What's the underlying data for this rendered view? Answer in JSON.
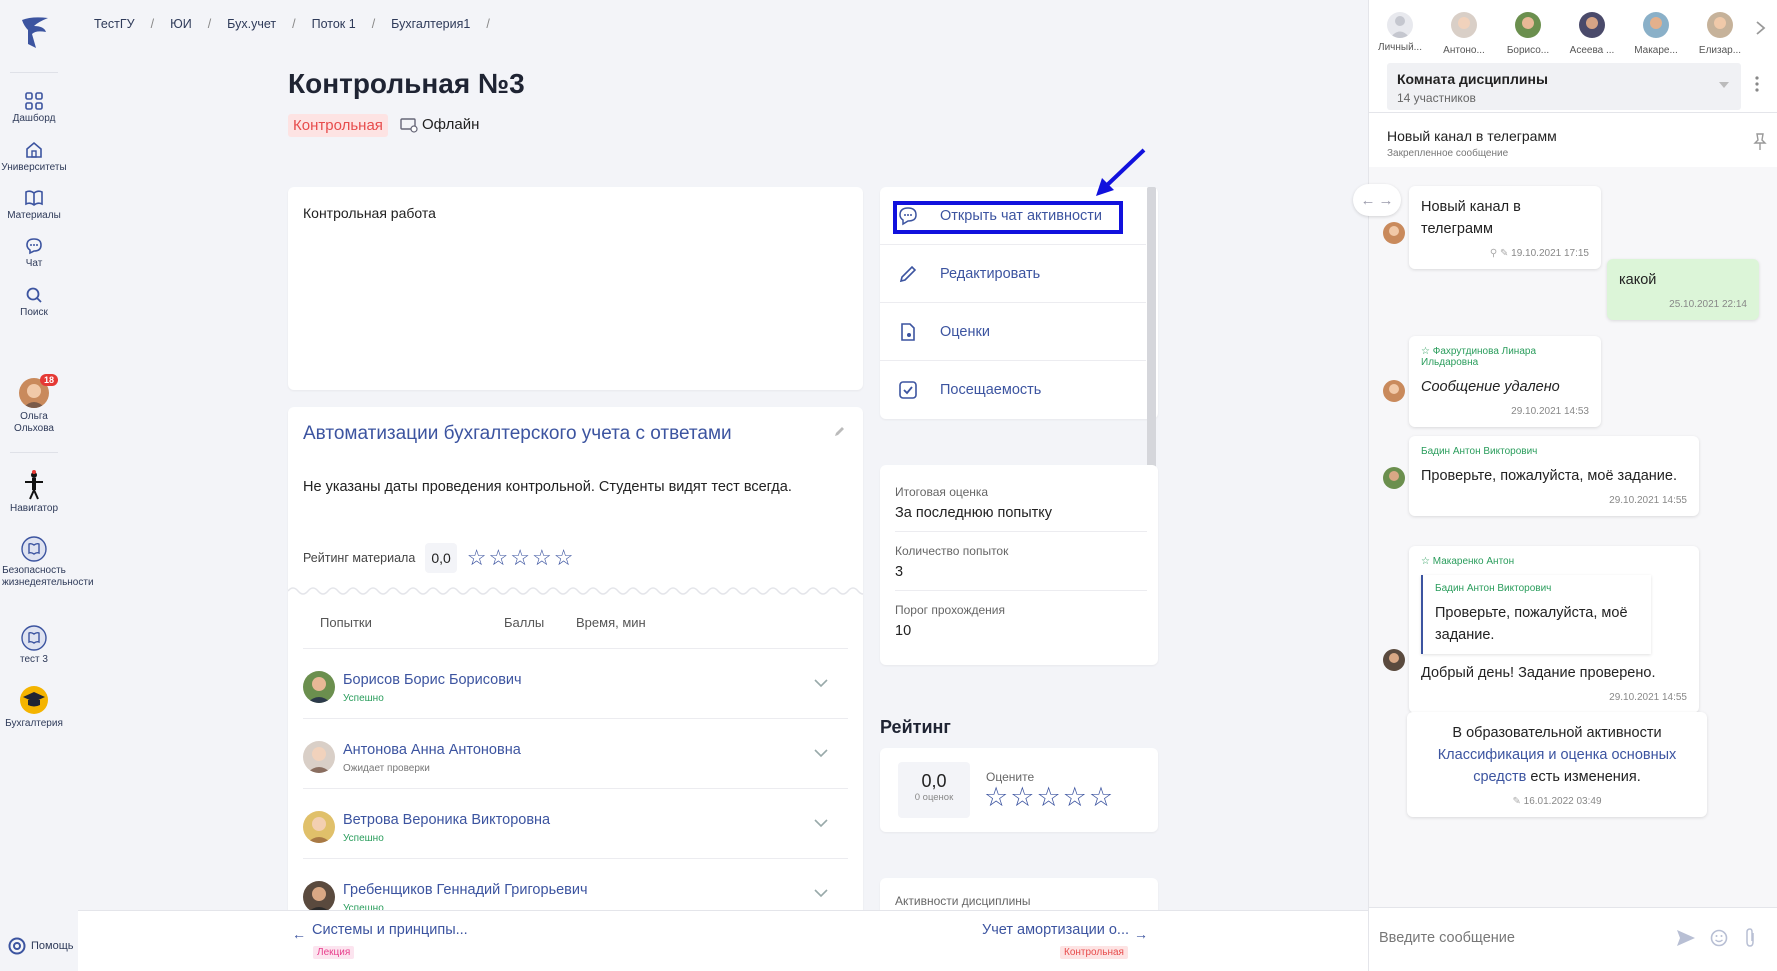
{
  "sidebar": {
    "items": [
      {
        "label": "Дашборд",
        "icon": "dashboard-icon"
      },
      {
        "label": "Университеты",
        "icon": "university-icon"
      },
      {
        "label": "Материалы",
        "icon": "book-icon"
      },
      {
        "label": "Чат",
        "icon": "chat-icon"
      },
      {
        "label": "Поиск",
        "icon": "search-icon"
      }
    ],
    "user": {
      "name": "Ольга Ольхова",
      "badge": "18"
    },
    "courses": [
      {
        "label": "Навигатор"
      },
      {
        "label": "Безопасность жизнедеятельности"
      },
      {
        "label": "тест 3"
      },
      {
        "label": "Бухгалтерия"
      }
    ],
    "help": "Помощь"
  },
  "breadcrumb": [
    "ТестГУ",
    "ЮИ",
    "Бух.учет",
    "Поток 1",
    "Бухгалтерия1"
  ],
  "page": {
    "title": "Контрольная №3",
    "type_tag": "Контрольная",
    "format": "Офлайн",
    "description": "Контрольная работа"
  },
  "test": {
    "title": "Автоматизации бухгалтерского учета с ответами",
    "note": "Не указаны даты проведения контрольной. Студенты видят тест всегда.",
    "rating_label": "Рейтинг материала",
    "rating_value": "0,0",
    "stars_filled": 0,
    "columns": [
      "Попытки",
      "Баллы",
      "Время, мин"
    ],
    "attempts": [
      {
        "name": "Борисов Борис Борисович",
        "status": "Успешно",
        "status_color": "#2a9d5c"
      },
      {
        "name": "Антонова Анна Антоновна",
        "status": "Ожидает проверки",
        "status_color": "#777777"
      },
      {
        "name": "Ветрова Вероника Викторовна",
        "status": "Успешно",
        "status_color": "#2a9d5c"
      },
      {
        "name": "Гребенщиков Геннадий Григорьевич",
        "status": "Успешно",
        "status_color": "#2a9d5c"
      }
    ]
  },
  "actions": {
    "open_chat": "Открыть чат активности",
    "edit": "Редактировать",
    "grades": "Оценки",
    "attendance": "Посещаемость"
  },
  "info": [
    {
      "key": "Итоговая оценка",
      "value": "За последнюю попытку"
    },
    {
      "key": "Количество попыток",
      "value": "3"
    },
    {
      "key": "Порог прохождения",
      "value": "10"
    }
  ],
  "rating": {
    "heading": "Рейтинг",
    "value": "0,0",
    "count": "0 оценок",
    "rate_label": "Оцените"
  },
  "discipline_activities": "Активности дисциплины",
  "bottom_nav": {
    "prev": "Системы и принципы...",
    "prev_tag": "Лекция",
    "next": "Учет амортизации о...",
    "next_tag": "Контрольная"
  },
  "chat": {
    "participants": [
      "Личный...",
      "Антоно...",
      "Борисо...",
      "Асеева ...",
      "Макаре...",
      "Елизар..."
    ],
    "room_title": "Комната дисциплины",
    "room_subtitle": "14 участников",
    "pinned_text": "Новый канал в телеграмм",
    "pinned_label": "Закрепленное сообщение",
    "messages": [
      {
        "text": "Новый канал в телеграмм",
        "time": "19.10.2021 17:15"
      },
      {
        "text": "какой",
        "time": "25.10.2021 22:14"
      },
      {
        "author": "Фахрутдинова Линара Ильдаровна",
        "text": "Сообщение удалено",
        "time": "29.10.2021 14:53"
      },
      {
        "author": "Бадин Антон Викторович",
        "text": "Проверьте, пожалуйста, моё задание.",
        "time": "29.10.2021 14:55"
      },
      {
        "author": "Макаренко Антон",
        "quote_author": "Бадин Антон Викторович",
        "quote_text": "Проверьте, пожалуйста, моё задание.",
        "text": "Добрый день! Задание проверено.",
        "time": "29.10.2021 14:55"
      },
      {
        "text_pre": "В образовательной активности",
        "link": "Классификация и оценка основных средств",
        "text_post": "есть изменения.",
        "time": "16.01.2022 03:49"
      }
    ],
    "input_placeholder": "Введите сообщение"
  },
  "colors": {
    "accent": "#3c54a0",
    "success": "#2a9d5c",
    "highlight": "#1111dd",
    "danger": "#e74c4c"
  }
}
